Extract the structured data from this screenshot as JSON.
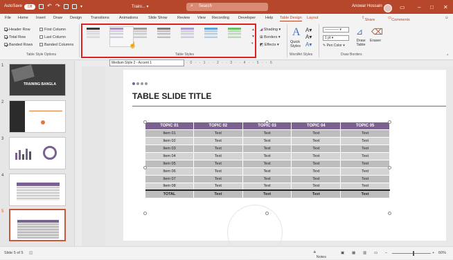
{
  "titlebar": {
    "autosave_label": "AutoSave",
    "autosave_state": "Off",
    "filename": "Traini... ▾",
    "search_label": "Search",
    "user": "Anowar Hossain"
  },
  "tabs": [
    "File",
    "Home",
    "Insert",
    "Draw",
    "Design",
    "Transitions",
    "Animations",
    "Slide Show",
    "Review",
    "View",
    "Recording",
    "Developer",
    "Help",
    "Table Design",
    "Layout"
  ],
  "active_tab": "Table Design",
  "share_label": "Share",
  "comments_label": "Comments",
  "table_style_options": {
    "items": [
      {
        "label": "Header Row",
        "checked": true
      },
      {
        "label": "First Column",
        "checked": false
      },
      {
        "label": "Total Row",
        "checked": true
      },
      {
        "label": "Last Column",
        "checked": false
      },
      {
        "label": "Banded Rows",
        "checked": true
      },
      {
        "label": "Banded Columns",
        "checked": false
      }
    ],
    "group_label": "Table Style Options"
  },
  "table_styles": {
    "group_label": "Table Styles",
    "swatch_colors": [
      "#3a3a3a",
      "#7b5fa0",
      "#9a9a9a",
      "#7f7f7f",
      "#a99ad0",
      "#5fa3d9",
      "#6abf69"
    ]
  },
  "shading": {
    "shading": "Shading",
    "borders": "Borders",
    "effects": "Effects"
  },
  "wordart": {
    "quick_styles": "Quick Styles",
    "group_label": "WordArt Styles"
  },
  "draw_borders": {
    "pen_weight": "1 pt",
    "pen_color": "Pen Color",
    "draw_table": "Draw Table",
    "eraser": "Eraser",
    "group_label": "Draw Borders"
  },
  "tooltip": "Medium Style 2 - Accent 1",
  "ruler_numbers": "5 · · 4 · · 3 · · 2 · · 1 · · 0 · · 1 · · 2 · · 3 · · 4 · · 5 · · 6",
  "thumbnails": [
    {
      "num": "1",
      "title": "TRAINING BANGLA"
    },
    {
      "num": "2"
    },
    {
      "num": "3"
    },
    {
      "num": "4"
    },
    {
      "num": "5"
    }
  ],
  "slide": {
    "title": "TABLE SLIDE TITLE",
    "dot_colors": [
      "#7b6190",
      "#9a9a9a",
      "#9a9a9a",
      "#9a9a9a"
    ],
    "accent": "#7b6190"
  },
  "table": {
    "headers": [
      "TOPIC 01",
      "TOPIC 02",
      "TOPIC 03",
      "TOPIC 04",
      "TOPIC 05"
    ],
    "rows": [
      [
        "Item 01",
        "Text",
        "Text",
        "Text",
        "Text"
      ],
      [
        "Item 02",
        "Text",
        "Text",
        "Text",
        "Text"
      ],
      [
        "Item 03",
        "Text",
        "Text",
        "Text",
        "Text"
      ],
      [
        "Item 04",
        "Text",
        "Text",
        "Text",
        "Text"
      ],
      [
        "Item 05",
        "Text",
        "Text",
        "Text",
        "Text"
      ],
      [
        "Item 06",
        "Text",
        "Text",
        "Text",
        "Text"
      ],
      [
        "Item 07",
        "Text",
        "Text",
        "Text",
        "Text"
      ],
      [
        "Item 08",
        "Text",
        "Text",
        "Text",
        "Text"
      ]
    ],
    "total": [
      "TOTAL",
      "Text",
      "Text",
      "Text",
      "Text"
    ]
  },
  "status": {
    "slide_info": "Slide 5 of 5",
    "notes": "Notes",
    "zoom": "60%"
  }
}
